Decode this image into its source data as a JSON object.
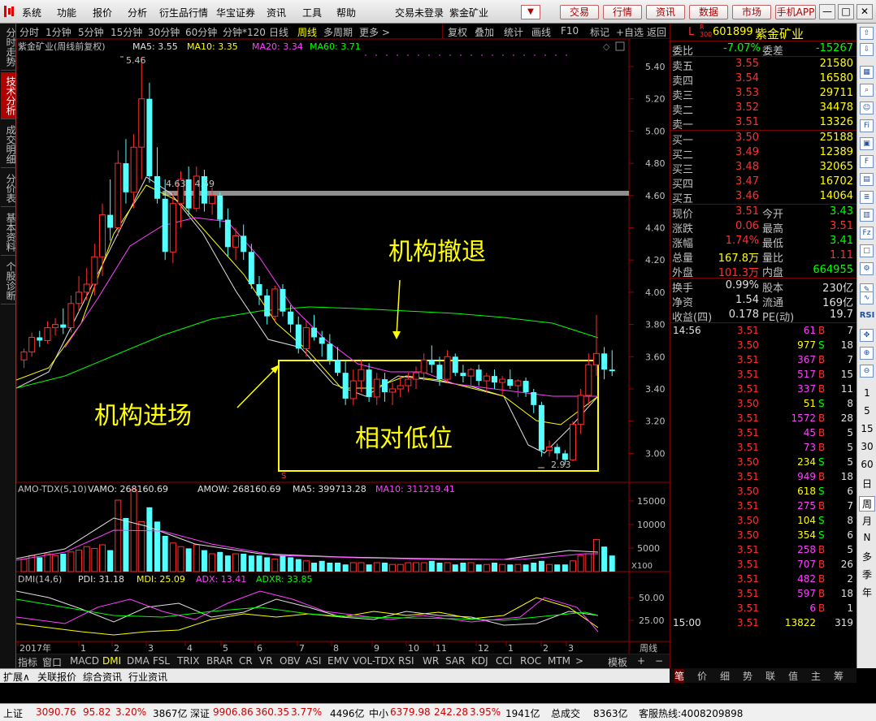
{
  "menu": {
    "items": [
      "系统",
      "功能",
      "报价",
      "分析",
      "衍生品行情",
      "华宝证券",
      "资讯",
      "工具",
      "帮助"
    ],
    "status": "交易未登录",
    "stock_name": "紫金矿业",
    "buttons": [
      "交易",
      "行情",
      "资讯",
      "数据",
      "市场",
      "手机APP"
    ],
    "window_buttons": [
      "—",
      "□",
      "✕"
    ]
  },
  "left_tabs": [
    {
      "label": "分时走势",
      "active": false
    },
    {
      "label": "技术分析",
      "active": true
    },
    {
      "label": "成交明细",
      "active": false
    },
    {
      "label": "分价表",
      "active": false
    },
    {
      "label": "基本资料",
      "active": false
    },
    {
      "label": "个股诊断",
      "active": false
    }
  ],
  "chart_toolbar": {
    "periods": [
      "分时",
      "1分钟",
      "5分钟",
      "15分钟",
      "30分钟",
      "60分钟",
      "分钟*120",
      "日线",
      "周线",
      "多周期",
      "更多 >"
    ],
    "active_period": "周线",
    "actions": [
      "复权",
      "叠加",
      "统计",
      "画线",
      "F10",
      "标记",
      "+自选",
      "返回"
    ]
  },
  "main_chart": {
    "title": "紫金矿业(周线前复权)",
    "ma_labels": [
      {
        "text": "MA5: 3.55",
        "color": "#e0e0e0"
      },
      {
        "text": "MA10: 3.35",
        "color": "#ffff00"
      },
      {
        "text": "MA20: 3.34",
        "color": "#ff40ff"
      },
      {
        "text": "MA60: 3.71",
        "color": "#00ff00"
      }
    ],
    "high_label": "5.46",
    "low_label": "2.93",
    "resistance_label": "4.63 - 4.59",
    "annotations": [
      "机构撤退",
      "机构进场",
      "相对低位"
    ],
    "y_ticks": [
      "5.40",
      "5.20",
      "5.00",
      "4.80",
      "4.60",
      "4.40",
      "4.20",
      "4.00",
      "3.80",
      "3.60",
      "3.40",
      "3.20",
      "3.00"
    ]
  },
  "volume_chart": {
    "title": "AMO-TDX(5,10)",
    "labels": [
      {
        "text": "VAMO: 268160.69",
        "color": "#e0e0e0"
      },
      {
        "text": "AMOW: 268160.69",
        "color": "#e0e0e0"
      },
      {
        "text": "MA5: 399713.28",
        "color": "#e0e0e0"
      },
      {
        "text": "MA10: 311219.41",
        "color": "#ff40ff"
      }
    ],
    "y_ticks": [
      "15000",
      "10000",
      "5000"
    ],
    "unit": "X100"
  },
  "dmi_chart": {
    "title": "DMI(14,6)",
    "labels": [
      {
        "text": "PDI: 31.18",
        "color": "#e0e0e0"
      },
      {
        "text": "MDI: 25.09",
        "color": "#ffff00"
      },
      {
        "text": "ADX: 13.41",
        "color": "#ff40ff"
      },
      {
        "text": "ADXR: 33.85",
        "color": "#00ff00"
      }
    ],
    "y_ticks": [
      "50.00",
      "25.00"
    ]
  },
  "time_axis": {
    "labels": [
      "2017年",
      "1",
      "2",
      "3",
      "4",
      "5",
      "6",
      "7",
      "8",
      "9",
      "10",
      "11",
      "12",
      "1",
      "2",
      "3"
    ],
    "period": "周线"
  },
  "indicator_tabs": [
    "指标",
    "窗口",
    "MACD",
    "DMI",
    "DMA",
    "FSL",
    "TRIX",
    "BRAR",
    "CR",
    "VR",
    "OBV",
    "ASI",
    "EMV",
    "VOL-TDX",
    "RSI",
    "WR",
    "SAR",
    "KDJ",
    "CCI",
    "ROC",
    "MTM",
    ">",
    "模板",
    "+",
    "−"
  ],
  "active_indicator": "DMI",
  "sub_tabs": [
    "扩展∧",
    "关联报价",
    "综合资讯",
    "行业资讯"
  ],
  "quote": {
    "code": "601899",
    "name": "紫金矿业",
    "tag": "L",
    "rz": "R 300",
    "wb_label": "委比",
    "wb": "-7.07%",
    "wc_label": "委差",
    "wc": "-15267",
    "sells": [
      {
        "label": "卖五",
        "price": "3.55",
        "vol": "21580"
      },
      {
        "label": "卖四",
        "price": "3.54",
        "vol": "16580"
      },
      {
        "label": "卖三",
        "price": "3.53",
        "vol": "29711"
      },
      {
        "label": "卖二",
        "price": "3.52",
        "vol": "34478"
      },
      {
        "label": "卖一",
        "price": "3.51",
        "vol": "13326"
      }
    ],
    "buys": [
      {
        "label": "买一",
        "price": "3.50",
        "vol": "25188"
      },
      {
        "label": "买二",
        "price": "3.49",
        "vol": "12389"
      },
      {
        "label": "买三",
        "price": "3.48",
        "vol": "32065"
      },
      {
        "label": "买四",
        "price": "3.47",
        "vol": "16702"
      },
      {
        "label": "买五",
        "price": "3.46",
        "vol": "14064"
      }
    ],
    "stats": [
      {
        "l1": "现价",
        "v1": "3.51",
        "c1": "red",
        "l2": "今开",
        "v2": "3.43",
        "c2": "grn"
      },
      {
        "l1": "涨跌",
        "v1": "0.06",
        "c1": "red",
        "l2": "最高",
        "v2": "3.51",
        "c2": "red"
      },
      {
        "l1": "涨幅",
        "v1": "1.74%",
        "c1": "red",
        "l2": "最低",
        "v2": "3.41",
        "c2": "grn"
      },
      {
        "l1": "总量",
        "v1": "167.8万",
        "c1": "yel",
        "l2": "量比",
        "v2": "1.11",
        "c2": "red"
      },
      {
        "l1": "外盘",
        "v1": "101.3万",
        "c1": "red",
        "l2": "内盘",
        "v2": "664955",
        "c2": "grn"
      }
    ],
    "stats2": [
      {
        "l1": "换手",
        "v1": "0.99%",
        "c1": "wht",
        "l2": "股本",
        "v2": "230亿",
        "c2": "wht"
      },
      {
        "l1": "净资",
        "v1": "1.54",
        "c1": "wht",
        "l2": "流通",
        "v2": "169亿",
        "c2": "wht"
      },
      {
        "l1": "收益(四)",
        "v1": "0.178",
        "c1": "wht",
        "l2": "PE(动)",
        "v2": "19.7",
        "c2": "wht"
      }
    ],
    "ticks": [
      {
        "t": "14:56",
        "p": "3.51",
        "v": "61",
        "d": "B",
        "n": "7"
      },
      {
        "t": "",
        "p": "3.50",
        "v": "977",
        "d": "S",
        "n": "18"
      },
      {
        "t": "",
        "p": "3.51",
        "v": "367",
        "d": "B",
        "n": "7"
      },
      {
        "t": "",
        "p": "3.51",
        "v": "517",
        "d": "B",
        "n": "15"
      },
      {
        "t": "",
        "p": "3.51",
        "v": "337",
        "d": "B",
        "n": "11"
      },
      {
        "t": "",
        "p": "3.50",
        "v": "51",
        "d": "S",
        "n": "8"
      },
      {
        "t": "",
        "p": "3.51",
        "v": "1572",
        "d": "B",
        "n": "28"
      },
      {
        "t": "",
        "p": "3.51",
        "v": "45",
        "d": "B",
        "n": "5"
      },
      {
        "t": "",
        "p": "3.51",
        "v": "73",
        "d": "B",
        "n": "5"
      },
      {
        "t": "",
        "p": "3.50",
        "v": "234",
        "d": "S",
        "n": "5"
      },
      {
        "t": "",
        "p": "3.51",
        "v": "949",
        "d": "B",
        "n": "18"
      },
      {
        "t": "",
        "p": "3.50",
        "v": "618",
        "d": "S",
        "n": "6"
      },
      {
        "t": "",
        "p": "3.51",
        "v": "275",
        "d": "B",
        "n": "7"
      },
      {
        "t": "",
        "p": "3.50",
        "v": "104",
        "d": "S",
        "n": "8"
      },
      {
        "t": "",
        "p": "3.50",
        "v": "354",
        "d": "S",
        "n": "6"
      },
      {
        "t": "",
        "p": "3.51",
        "v": "258",
        "d": "B",
        "n": "5"
      },
      {
        "t": "",
        "p": "3.51",
        "v": "707",
        "d": "B",
        "n": "26"
      },
      {
        "t": "",
        "p": "3.51",
        "v": "482",
        "d": "B",
        "n": "2"
      },
      {
        "t": "",
        "p": "3.51",
        "v": "597",
        "d": "B",
        "n": "18"
      },
      {
        "t": "",
        "p": "3.51",
        "v": "6",
        "d": "B",
        "n": "1"
      },
      {
        "t": "15:00",
        "p": "3.51",
        "v": "13822",
        "d": "",
        "n": "319"
      }
    ],
    "bottom_tabs": [
      "笔",
      "价",
      "细",
      "势",
      "联",
      "值",
      "主",
      "筹"
    ]
  },
  "icon_strip": {
    "icons": [
      "arrow-up-icon",
      "arrow-down-icon",
      "grid-icon",
      "search-icon",
      "fin-icon",
      "box-icon",
      "fiz-icon",
      "settings-icon",
      "pencil-icon",
      "wave-icon",
      "rsi-icon",
      "move-icon",
      "zoom-in-icon",
      "zoom-out-icon"
    ],
    "labels": [
      "RSI",
      "1",
      "5",
      "15",
      "30",
      "60",
      "日",
      "周",
      "月",
      "N",
      "多",
      "季",
      "年"
    ]
  },
  "status_bar": {
    "sh_label": "上证",
    "sh": "3090.76",
    "sh_chg": "95.82",
    "sh_pct": "3.20%",
    "sh_amt": "3867亿",
    "sz_label": "深证",
    "sz": "9906.86",
    "sz_chg": "360.35",
    "sz_pct": "3.77%",
    "sz_amt": "4496亿",
    "zx_label": "中小",
    "zx": "6379.98",
    "zx_chg": "242.28",
    "zx_pct": "3.95%",
    "zx_amt": "1941亿",
    "total_label": "总成交",
    "total": "8363亿",
    "hotline": "客服热线:4008209898"
  }
}
